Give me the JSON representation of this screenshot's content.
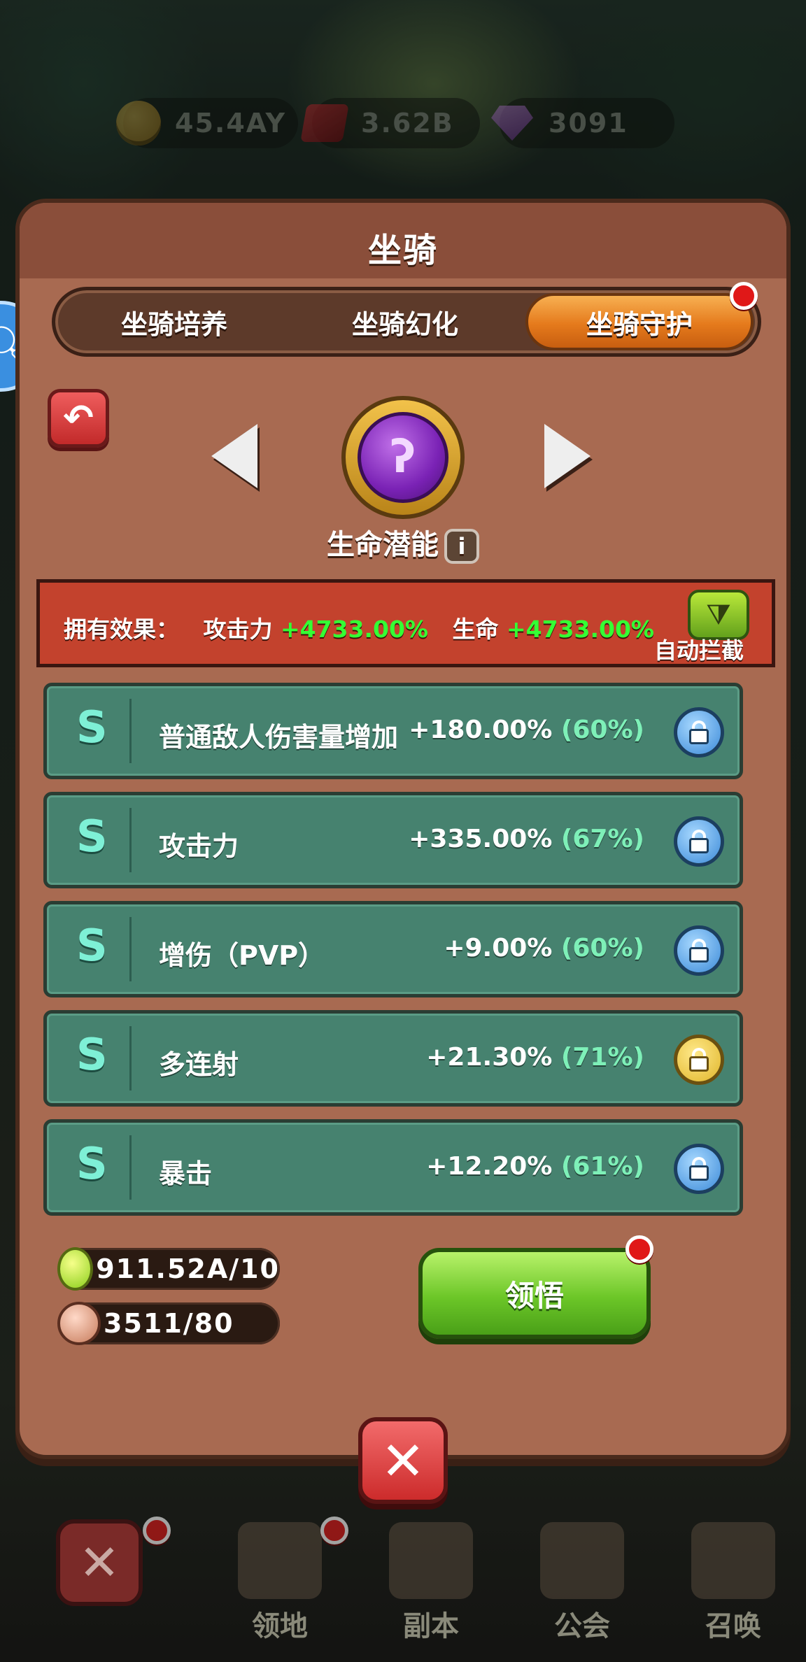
{
  "resources": [
    {
      "icon": "gold-coin-icon",
      "value": "45.4AY"
    },
    {
      "icon": "ruby-icon",
      "value": "3.62B"
    },
    {
      "icon": "diamond-icon",
      "value": "3091"
    }
  ],
  "panel": {
    "title": "坐骑",
    "tabs": [
      {
        "label": "坐骑培养",
        "active": false
      },
      {
        "label": "坐骑幻化",
        "active": false
      },
      {
        "label": "坐骑守护",
        "active": true
      }
    ],
    "emblem_name": "生命潜能",
    "info_label": "i"
  },
  "effects": {
    "label": "拥有效果：",
    "attack_label": "攻击力",
    "attack_value": "+4733.00%",
    "life_label": "生命",
    "life_value": "+4733.00%",
    "auto_label": "自动拦截"
  },
  "stats": [
    {
      "grade": "S",
      "name": "普通敌人伤害量增加",
      "value": "+180.00%",
      "pct": "(60%)",
      "lock": "blue"
    },
    {
      "grade": "S",
      "name": "攻击力",
      "value": "+335.00%",
      "pct": "(67%)",
      "lock": "blue"
    },
    {
      "grade": "S",
      "name": "增伤（PVP）",
      "value": "+9.00%",
      "pct": "(60%)",
      "lock": "blue"
    },
    {
      "grade": "S",
      "name": "多连射",
      "value": "+21.30%",
      "pct": "(71%)",
      "lock": "gold"
    },
    {
      "grade": "S",
      "name": "暴击",
      "value": "+12.20%",
      "pct": "(61%)",
      "lock": "blue"
    }
  ],
  "costs": [
    {
      "icon": "green-gem-icon",
      "value": "911.52A/10"
    },
    {
      "icon": "lock-stone-icon",
      "value": "3511/80"
    }
  ],
  "learn_label": "领悟",
  "nav": [
    {
      "label": "领地"
    },
    {
      "label": "副本"
    },
    {
      "label": "公会"
    },
    {
      "label": "召唤"
    }
  ],
  "colors": {
    "panel": "#a86a51",
    "row": "#46826f",
    "accent_orange": "#e57a1c",
    "effect_bar": "#c3422d",
    "green_value": "#34ff34"
  }
}
